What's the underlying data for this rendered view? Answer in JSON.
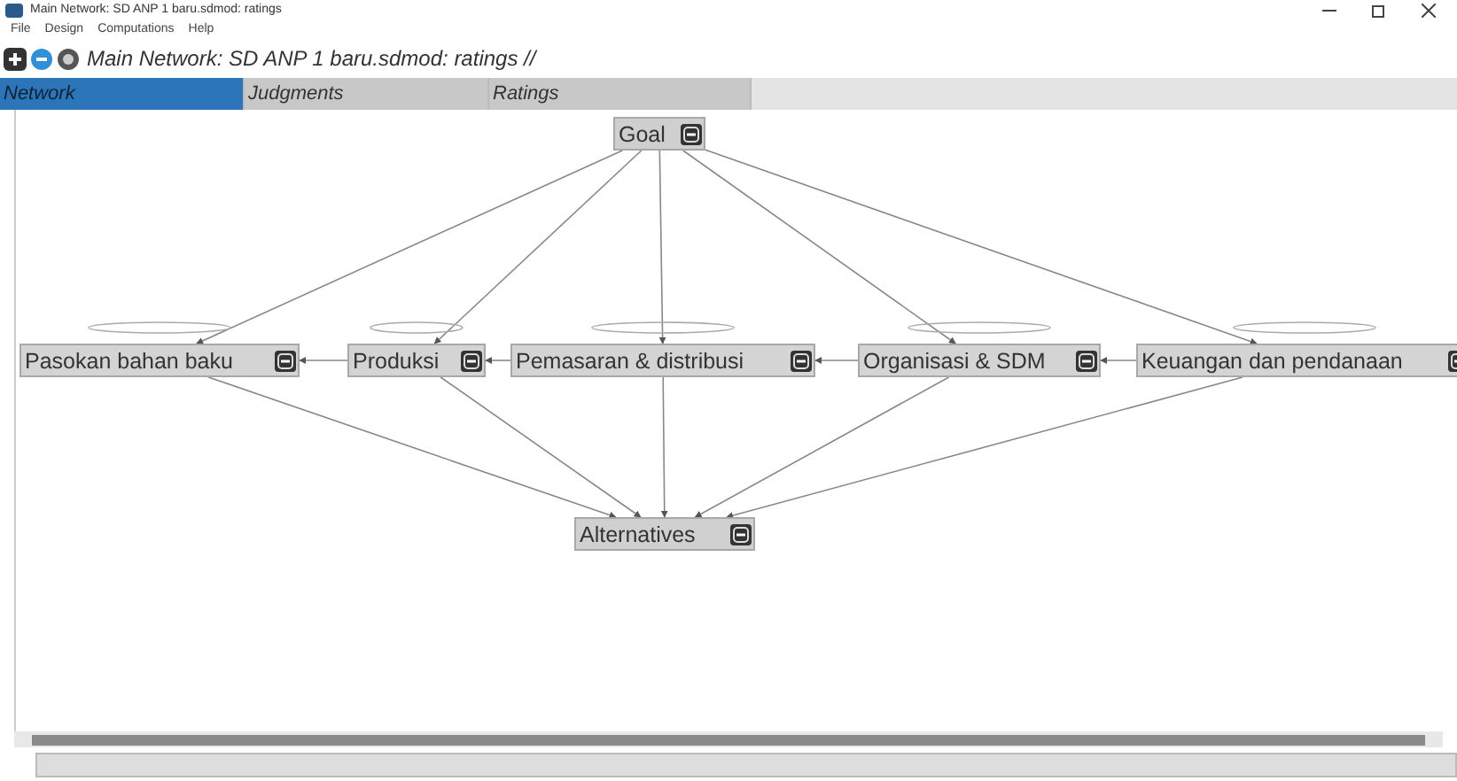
{
  "window": {
    "title": "Main Network: SD ANP 1 baru.sdmod: ratings"
  },
  "menu": [
    "File",
    "Design",
    "Computations",
    "Help"
  ],
  "toolbar": {
    "title": "Main Network: SD ANP 1 baru.sdmod: ratings //"
  },
  "tabs": [
    {
      "label": "Network",
      "selected": true
    },
    {
      "label": "Judgments",
      "selected": false
    },
    {
      "label": "Ratings",
      "selected": false
    }
  ],
  "nodes": [
    {
      "label": "Goal",
      "kind": "goal"
    },
    {
      "label": "Pasokan bahan baku",
      "kind": "cluster"
    },
    {
      "label": "Produksi",
      "kind": "cluster"
    },
    {
      "label": "Pemasaran & distribusi",
      "kind": "cluster"
    },
    {
      "label": "Organisasi & SDM",
      "kind": "cluster"
    },
    {
      "label": "Keuangan dan pendanaan",
      "kind": "cluster"
    },
    {
      "label": "Alternatives",
      "kind": "alternatives"
    }
  ]
}
